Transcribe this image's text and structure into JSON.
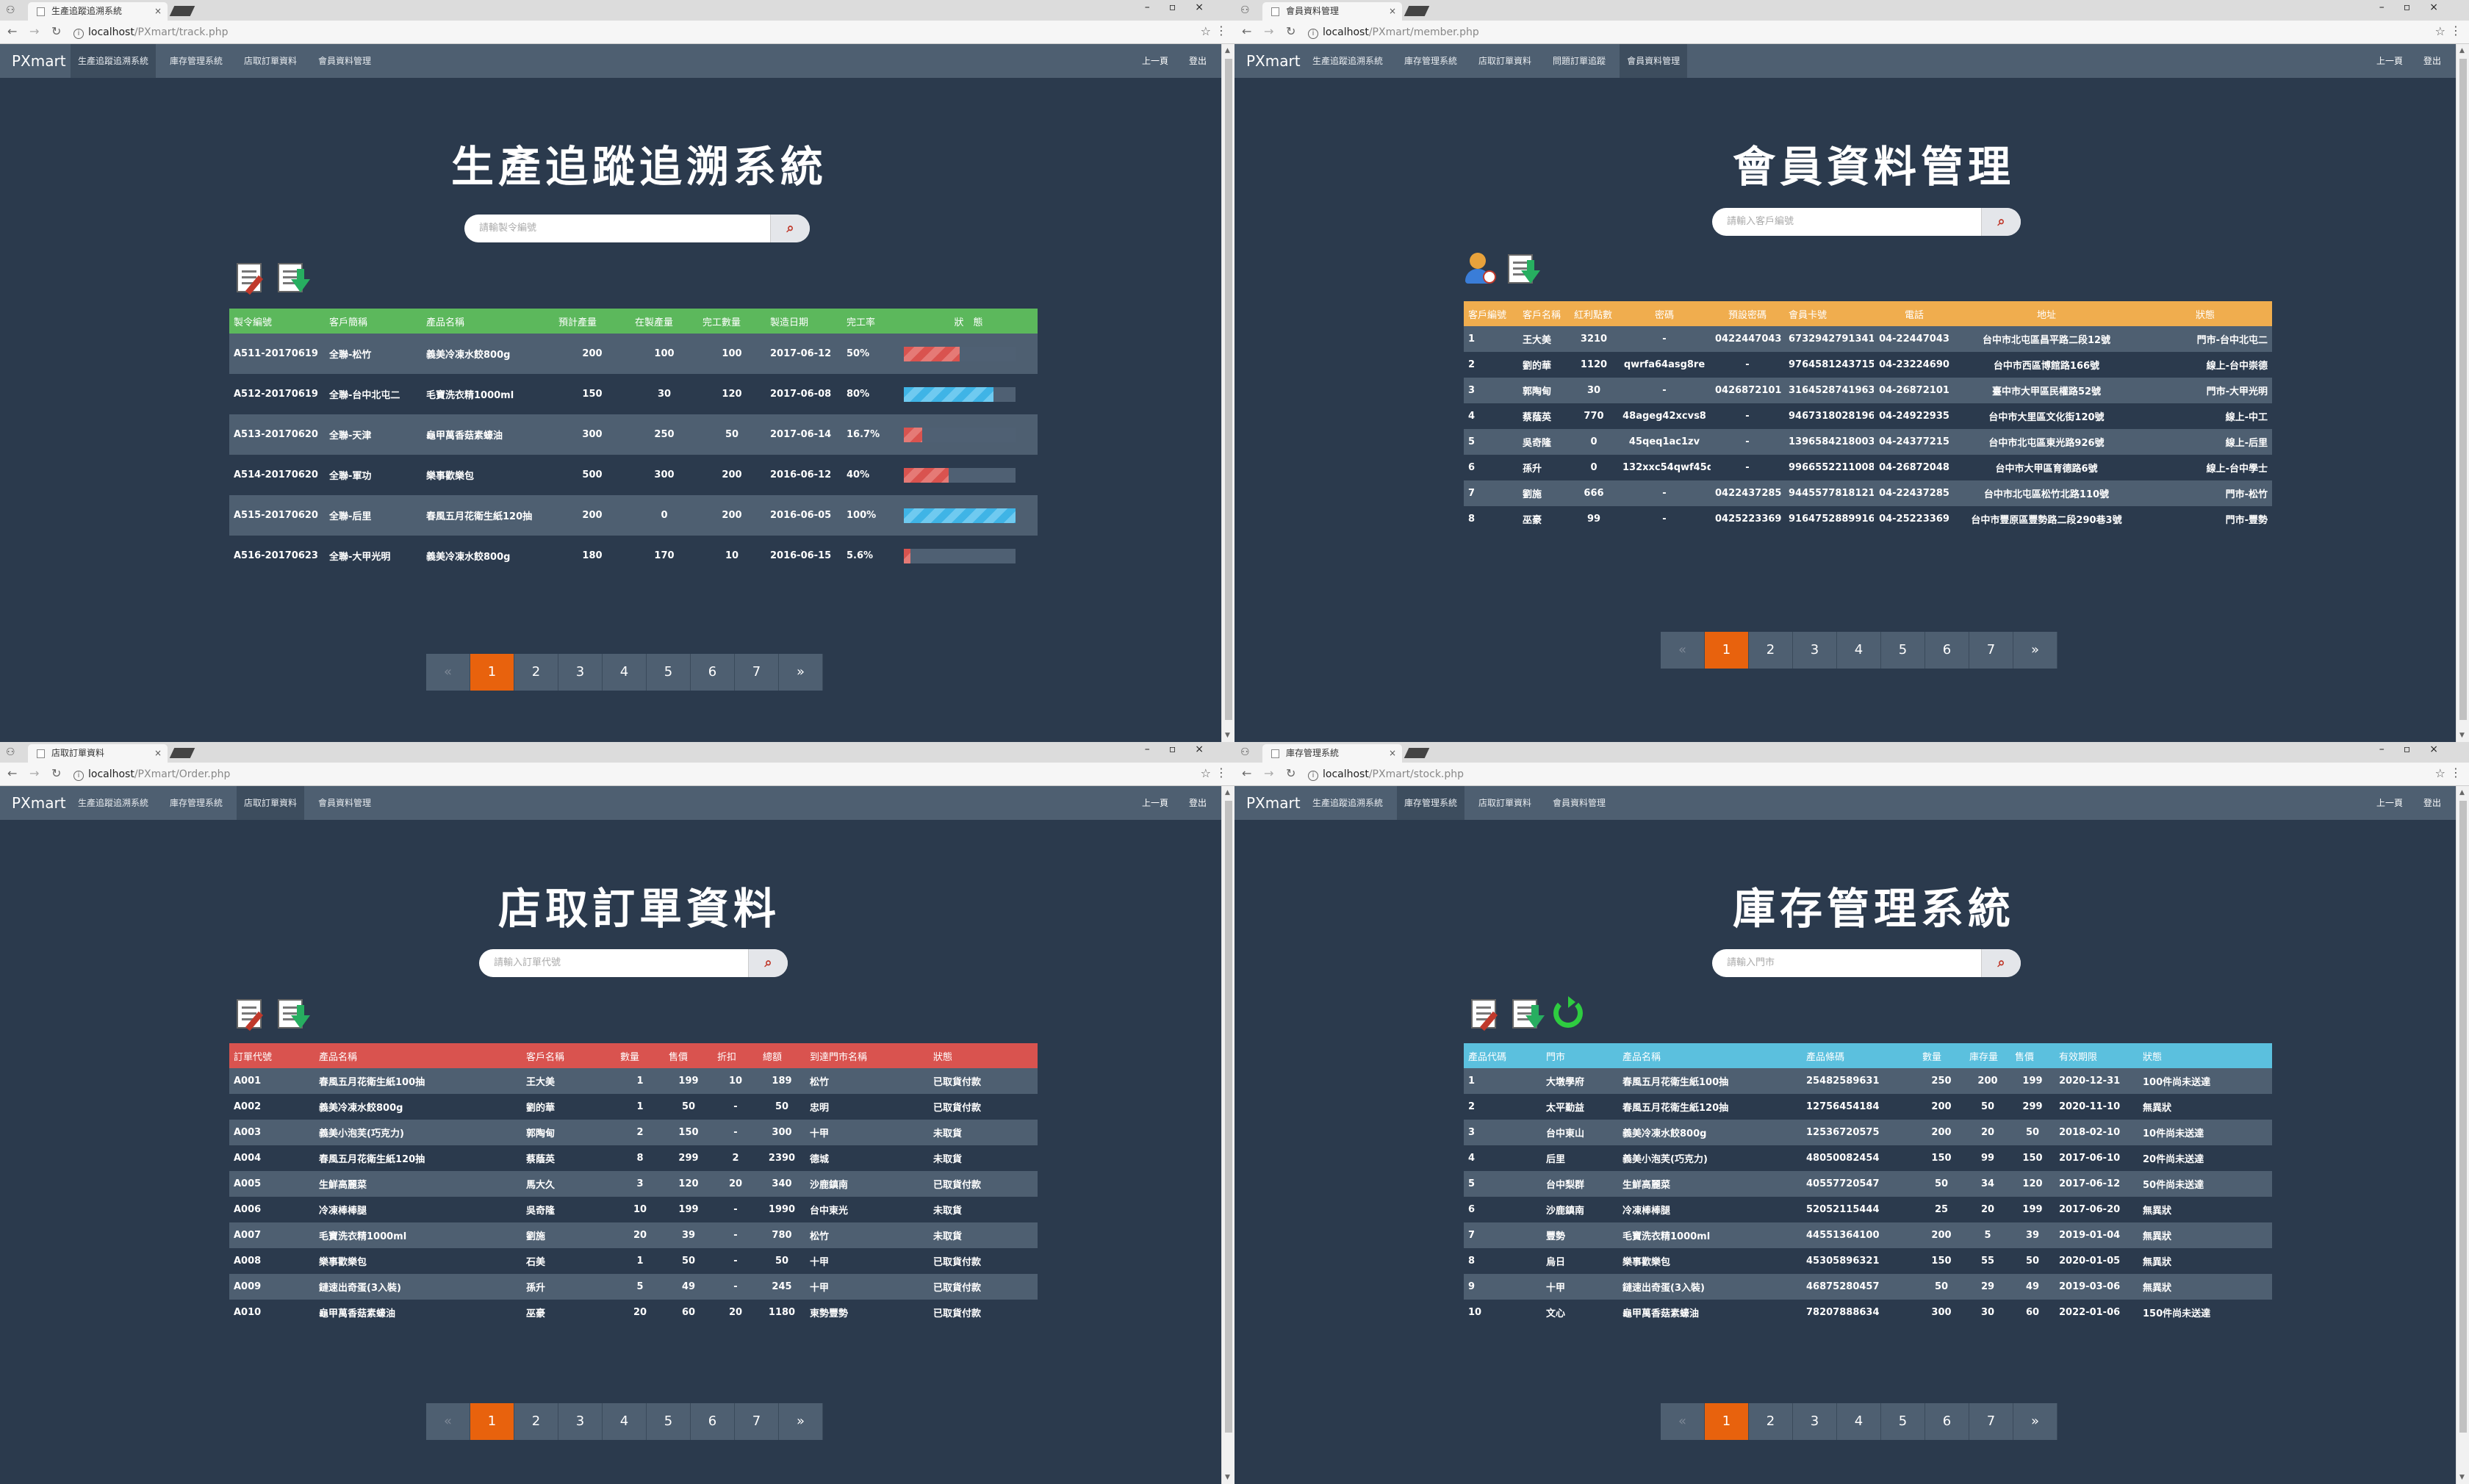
{
  "common": {
    "brand": "PXmart",
    "nav_back": "上一頁",
    "nav_logout": "登出",
    "url_host": "localhost",
    "pagination": [
      "«",
      "1",
      "2",
      "3",
      "4",
      "5",
      "6",
      "7",
      "»"
    ]
  },
  "w1": {
    "tab_title": "生產追蹤追溯系統",
    "url_path": "/PXmart/track.php",
    "nav": [
      "生產追蹤追溯系統",
      "庫存管理系統",
      "店取訂單資料",
      "會員資料管理"
    ],
    "active_nav": 0,
    "title": "生產追蹤追溯系統",
    "search_placeholder": "請輸製令編號",
    "header_color": "#5cb85c",
    "columns": [
      "製令編號",
      "客戶簡稱",
      "產品名稱",
      "預計產量",
      "在製產量",
      "完工數量",
      "製造日期",
      "完工率",
      "狀　態"
    ],
    "rows": [
      {
        "id": "A511-20170619",
        "cust": "全聯-松竹",
        "prod": "義美冷凍水餃800g",
        "plan": "200",
        "wip": "100",
        "done": "100",
        "date": "2017-06-12",
        "rate": "50%",
        "pct": 50,
        "color": "red"
      },
      {
        "id": "A512-20170619",
        "cust": "全聯-台中北屯二",
        "prod": "毛寶洗衣精1000ml",
        "plan": "150",
        "wip": "30",
        "done": "120",
        "date": "2017-06-08",
        "rate": "80%",
        "pct": 80,
        "color": "blue"
      },
      {
        "id": "A513-20170620",
        "cust": "全聯-天津",
        "prod": "龜甲萬香菇素蠔油",
        "plan": "300",
        "wip": "250",
        "done": "50",
        "date": "2017-06-14",
        "rate": "16.7%",
        "pct": 16.7,
        "color": "red"
      },
      {
        "id": "A514-20170620",
        "cust": "全聯-軍功",
        "prod": "樂事歡樂包",
        "plan": "500",
        "wip": "300",
        "done": "200",
        "date": "2016-06-12",
        "rate": "40%",
        "pct": 40,
        "color": "red"
      },
      {
        "id": "A515-20170620",
        "cust": "全聯-后里",
        "prod": "春風五月花衛生紙120抽",
        "plan": "200",
        "wip": "0",
        "done": "200",
        "date": "2016-06-05",
        "rate": "100%",
        "pct": 100,
        "color": "blue"
      },
      {
        "id": "A516-20170623",
        "cust": "全聯-大甲光明",
        "prod": "義美冷凍水餃800g",
        "plan": "180",
        "wip": "170",
        "done": "10",
        "date": "2016-06-15",
        "rate": "5.6%",
        "pct": 5.6,
        "color": "red"
      }
    ]
  },
  "w2": {
    "tab_title": "會員資料管理",
    "url_path": "/PXmart/member.php",
    "nav": [
      "生產追蹤追溯系統",
      "庫存管理系統",
      "店取訂單資料",
      "問題訂單追蹤",
      "會員資料管理"
    ],
    "active_nav": 4,
    "title": "會員資料管理",
    "search_placeholder": "請輸入客戶編號",
    "header_color": "#f0ad4e",
    "columns": [
      "客戶編號",
      "客戶名稱",
      "紅利點數",
      "密碼",
      "預設密碼",
      "會員卡號",
      "電話",
      "地址",
      "狀態"
    ],
    "rows": [
      [
        "1",
        "王大美",
        "3210",
        "-",
        "0422447043",
        "6732942791341",
        "04-22447043",
        "台中市北屯區昌平路二段12號",
        "門市-台中北屯二"
      ],
      [
        "2",
        "劉的華",
        "1120",
        "qwrfa64asg8re",
        "-",
        "9764581243715",
        "04-23224690",
        "台中市西區博館路166號",
        "線上-台中崇德"
      ],
      [
        "3",
        "郭陶甸",
        "30",
        "-",
        "0426872101",
        "3164528741963",
        "04-26872101",
        "臺中市大甲區民權路52號",
        "門市-大甲光明"
      ],
      [
        "4",
        "蔡蔭英",
        "770",
        "48ageg42xcvs8",
        "-",
        "9467318028196",
        "04-24922935",
        "台中市大里區文化街120號",
        "線上-中工"
      ],
      [
        "5",
        "吳奇隆",
        "0",
        "45qeq1ac1zv",
        "-",
        "1396584218003",
        "04-24377215",
        "台中市北屯區東光路926號",
        "線上-后里"
      ],
      [
        "6",
        "孫升",
        "0",
        "132xxc54qwf45q",
        "-",
        "9966552211008",
        "04-26872048",
        "台中市大甲區育德路6號",
        "線上-台中學士"
      ],
      [
        "7",
        "劉施",
        "666",
        "-",
        "0422437285",
        "9445577818121",
        "04-22437285",
        "台中市北屯區松竹北路110號",
        "門市-松竹"
      ],
      [
        "8",
        "巫豪",
        "99",
        "-",
        "0425223369",
        "9164752889916",
        "04-25223369",
        "台中市豐原區豐勢路二段290巷3號",
        "門市-豐勢"
      ]
    ]
  },
  "w3": {
    "tab_title": "店取訂單資料",
    "url_path": "/PXmart/Order.php",
    "nav": [
      "生產追蹤追溯系統",
      "庫存管理系統",
      "店取訂單資料",
      "會員資料管理"
    ],
    "active_nav": 2,
    "title": "店取訂單資料",
    "search_placeholder": "請輸入訂單代號",
    "header_color": "#d9534f",
    "columns": [
      "訂單代號",
      "產品名稱",
      "客戶名稱",
      "數量",
      "售價",
      "折扣",
      "總額",
      "到達門市名稱",
      "狀態"
    ],
    "rows": [
      [
        "A001",
        "春風五月花衛生紙100抽",
        "王大美",
        "1",
        "199",
        "10",
        "189",
        "松竹",
        "已取貨付款"
      ],
      [
        "A002",
        "義美冷凍水餃800g",
        "劉的華",
        "1",
        "50",
        "-",
        "50",
        "忠明",
        "已取貨付款"
      ],
      [
        "A003",
        "義美小泡芙(巧克力)",
        "郭陶甸",
        "2",
        "150",
        "-",
        "300",
        "十甲",
        "未取貨"
      ],
      [
        "A004",
        "春風五月花衛生紙120抽",
        "蔡蔭英",
        "8",
        "299",
        "2",
        "2390",
        "德城",
        "未取貨"
      ],
      [
        "A005",
        "生鮮高麗菜",
        "馬大久",
        "3",
        "120",
        "20",
        "340",
        "沙鹿鎮南",
        "已取貨付款"
      ],
      [
        "A006",
        "冷凍棒棒腿",
        "吳奇隆",
        "10",
        "199",
        "-",
        "1990",
        "台中東光",
        "未取貨"
      ],
      [
        "A007",
        "毛寶洗衣精1000ml",
        "劉施",
        "20",
        "39",
        "-",
        "780",
        "松竹",
        "未取貨"
      ],
      [
        "A008",
        "樂事歡樂包",
        "石美",
        "1",
        "50",
        "-",
        "50",
        "十甲",
        "已取貨付款"
      ],
      [
        "A009",
        "鏈速出奇蛋(3入裝)",
        "孫升",
        "5",
        "49",
        "-",
        "245",
        "十甲",
        "已取貨付款"
      ],
      [
        "A010",
        "龜甲萬香菇素蠔油",
        "巫豪",
        "20",
        "60",
        "20",
        "1180",
        "東勢豐勢",
        "已取貨付款"
      ]
    ]
  },
  "w4": {
    "tab_title": "庫存管理系統",
    "url_path": "/PXmart/stock.php",
    "nav": [
      "生產追蹤追溯系統",
      "庫存管理系統",
      "店取訂單資料",
      "會員資料管理"
    ],
    "active_nav": 1,
    "title": "庫存管理系統",
    "search_placeholder": "請輸入門市",
    "header_color": "#5bc0de",
    "columns": [
      "產品代碼",
      "門市",
      "產品名稱",
      "產品條碼",
      "數量",
      "庫存量",
      "售價",
      "有效期限",
      "狀態"
    ],
    "rows": [
      [
        "1",
        "大墩學府",
        "春風五月花衛生紙100抽",
        "25482589631",
        "250",
        "200",
        "199",
        "2020-12-31",
        "100件尚未送達"
      ],
      [
        "2",
        "太平勤益",
        "春風五月花衛生紙120抽",
        "12756454184",
        "200",
        "50",
        "299",
        "2020-11-10",
        "無異狀"
      ],
      [
        "3",
        "台中東山",
        "義美冷凍水餃800g",
        "12536720575",
        "200",
        "20",
        "50",
        "2018-02-10",
        "10件尚未送達"
      ],
      [
        "4",
        "后里",
        "義美小泡芙(巧克力)",
        "48050082454",
        "150",
        "99",
        "150",
        "2017-06-10",
        "20件尚未送達"
      ],
      [
        "5",
        "台中梨群",
        "生鮮高麗菜",
        "40557720547",
        "50",
        "34",
        "120",
        "2017-06-12",
        "50件尚未送達"
      ],
      [
        "6",
        "沙鹿鎮南",
        "冷凍棒棒腿",
        "52052115444",
        "25",
        "20",
        "199",
        "2017-06-20",
        "無異狀"
      ],
      [
        "7",
        "豐勢",
        "毛寶洗衣精1000ml",
        "44551364100",
        "200",
        "5",
        "39",
        "2019-01-04",
        "無異狀"
      ],
      [
        "8",
        "烏日",
        "樂事歡樂包",
        "45305896321",
        "150",
        "55",
        "50",
        "2020-01-05",
        "無異狀"
      ],
      [
        "9",
        "十甲",
        "鏈速出奇蛋(3入裝)",
        "46875280457",
        "50",
        "29",
        "49",
        "2019-03-06",
        "無異狀"
      ],
      [
        "10",
        "文心",
        "龜甲萬香菇素蠔油",
        "78207888634",
        "300",
        "30",
        "60",
        "2022-01-06",
        "150件尚未送達"
      ]
    ]
  }
}
